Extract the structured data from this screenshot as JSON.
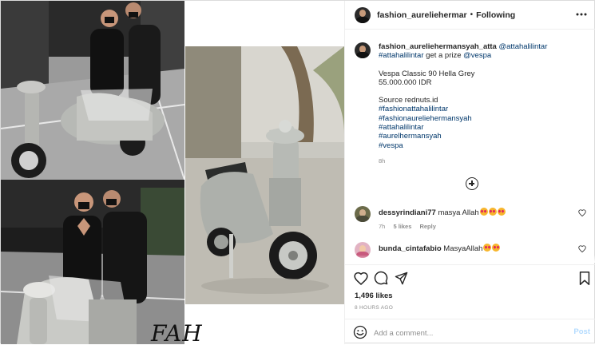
{
  "header": {
    "username": "fashion_aureliehermar",
    "separator": "•",
    "follow_status": "Following",
    "more_icon": "more-horizontal-icon"
  },
  "media": {
    "watermark": "FAH"
  },
  "caption": {
    "username": "fashion_aureliehermansyah_atta",
    "mention_1": "@attahalilintar",
    "hashtag_1": "#attahalilintar",
    "text_1": " get a prize ",
    "mention_2": "@vespa",
    "title": "Vespa Classic 90 Hella Grey",
    "price": "55.000.000 IDR",
    "source": "Source rednuts.id",
    "hashtags": [
      "#fashionattahalilintar",
      "#fashionaureliehermansyah",
      "#attahalilintar",
      "#aurelhermansyah",
      "#vespa"
    ],
    "time": "8h"
  },
  "load_more_icon": "plus-circle-icon",
  "comments": [
    {
      "username": "dessyrindiani77",
      "text": "masya Allah",
      "emoji_count": 3,
      "time": "7h",
      "likes": "5 likes",
      "reply": "Reply"
    },
    {
      "username": "bunda_cintafabio",
      "text": "MasyaAllah",
      "emoji_count": 2
    }
  ],
  "actions": {
    "likes": "1,496 likes",
    "posted": "8 HOURS AGO",
    "add_comment_placeholder": "Add a comment...",
    "post_label": "Post"
  },
  "colors": {
    "link": "#00376b",
    "post_button_disabled": "#b3dbff",
    "muted": "#8e8e8e",
    "border": "#dbdbdb"
  }
}
